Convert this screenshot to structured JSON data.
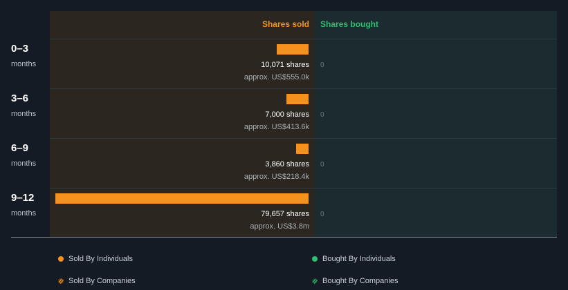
{
  "colors": {
    "sold": "#f6911e",
    "bought": "#2fbf71"
  },
  "headers": {
    "sold": "Shares sold",
    "bought": "Shares bought"
  },
  "rows": [
    {
      "period": "0–3",
      "unit": "months",
      "shares_label": "10,071 shares",
      "value_label": "approx. US$555.0k",
      "bought_label": "0"
    },
    {
      "period": "3–6",
      "unit": "months",
      "shares_label": "7,000 shares",
      "value_label": "approx. US$413.6k",
      "bought_label": "0"
    },
    {
      "period": "6–9",
      "unit": "months",
      "shares_label": "3,860 shares",
      "value_label": "approx. US$218.4k",
      "bought_label": "0"
    },
    {
      "period": "9–12",
      "unit": "months",
      "shares_label": "79,657 shares",
      "value_label": "approx. US$3.8m",
      "bought_label": "0"
    }
  ],
  "legend": {
    "sold_individuals": "Sold By Individuals",
    "bought_individuals": "Bought By Individuals",
    "sold_companies": "Sold By Companies",
    "bought_companies": "Bought By Companies"
  },
  "chart_data": {
    "type": "bar",
    "orientation": "horizontal",
    "categories": [
      "0–3",
      "3–6",
      "6–9",
      "9–12"
    ],
    "series": [
      {
        "name": "Shares sold",
        "values": [
          10071,
          7000,
          3860,
          79657
        ]
      },
      {
        "name": "Shares bought",
        "values": [
          0,
          0,
          0,
          0
        ]
      }
    ],
    "xlim": [
      0,
      79657
    ],
    "grid": false,
    "legend_position": "bottom"
  }
}
